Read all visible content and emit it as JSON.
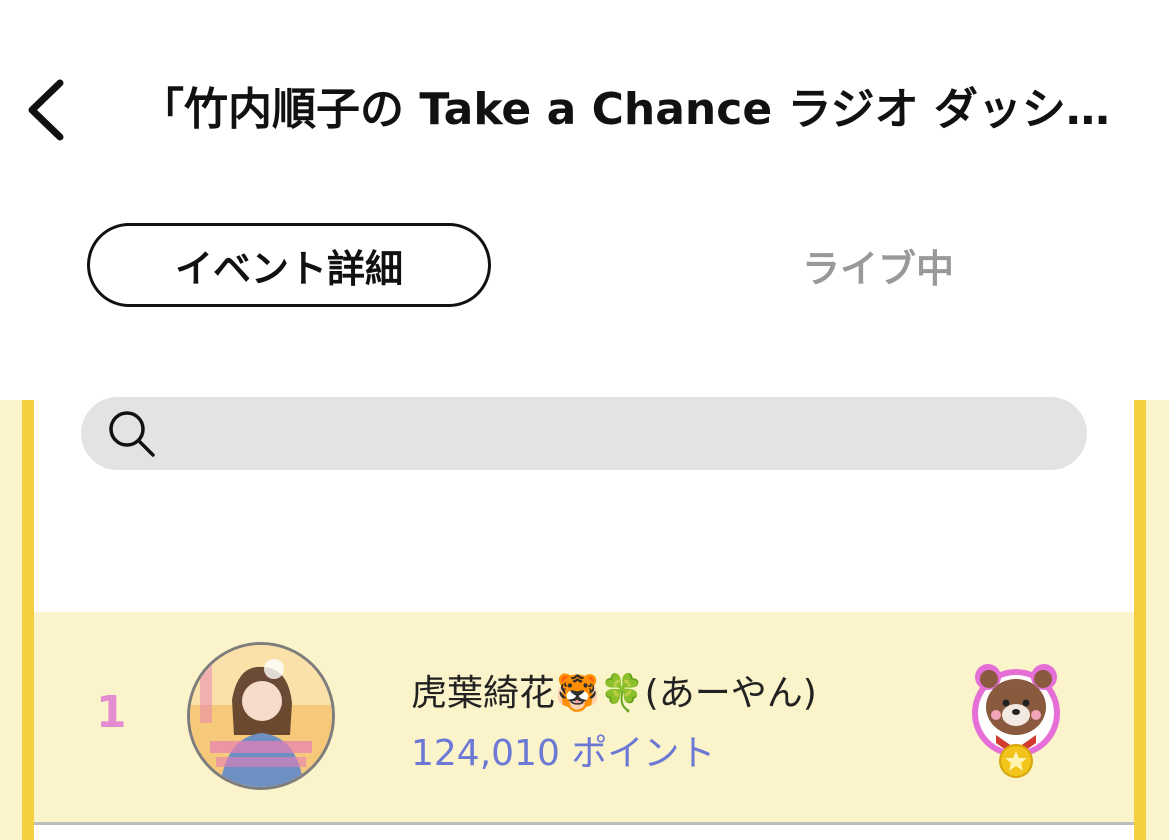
{
  "header": {
    "title": "「竹内順子の Take a Chance ラジオ ダッシ…",
    "back_icon": "chevron-left-icon"
  },
  "tabs": [
    {
      "label": "イベント詳細",
      "active": true
    },
    {
      "label": "ライブ中",
      "active": false
    }
  ],
  "search": {
    "placeholder": "",
    "value": "",
    "icon": "search-icon"
  },
  "ranking": [
    {
      "rank": "1",
      "name": "虎葉綺花🐯🍀(あーやん)",
      "points": "124,010 ポイント",
      "badge_icon": "bear-medal-icon"
    }
  ],
  "colors": {
    "panel_bg": "#fbf3c9",
    "panel_border": "#f4d040",
    "rank": "#e48bd2",
    "points": "#6b78d6",
    "inactive_tab": "#999999"
  }
}
